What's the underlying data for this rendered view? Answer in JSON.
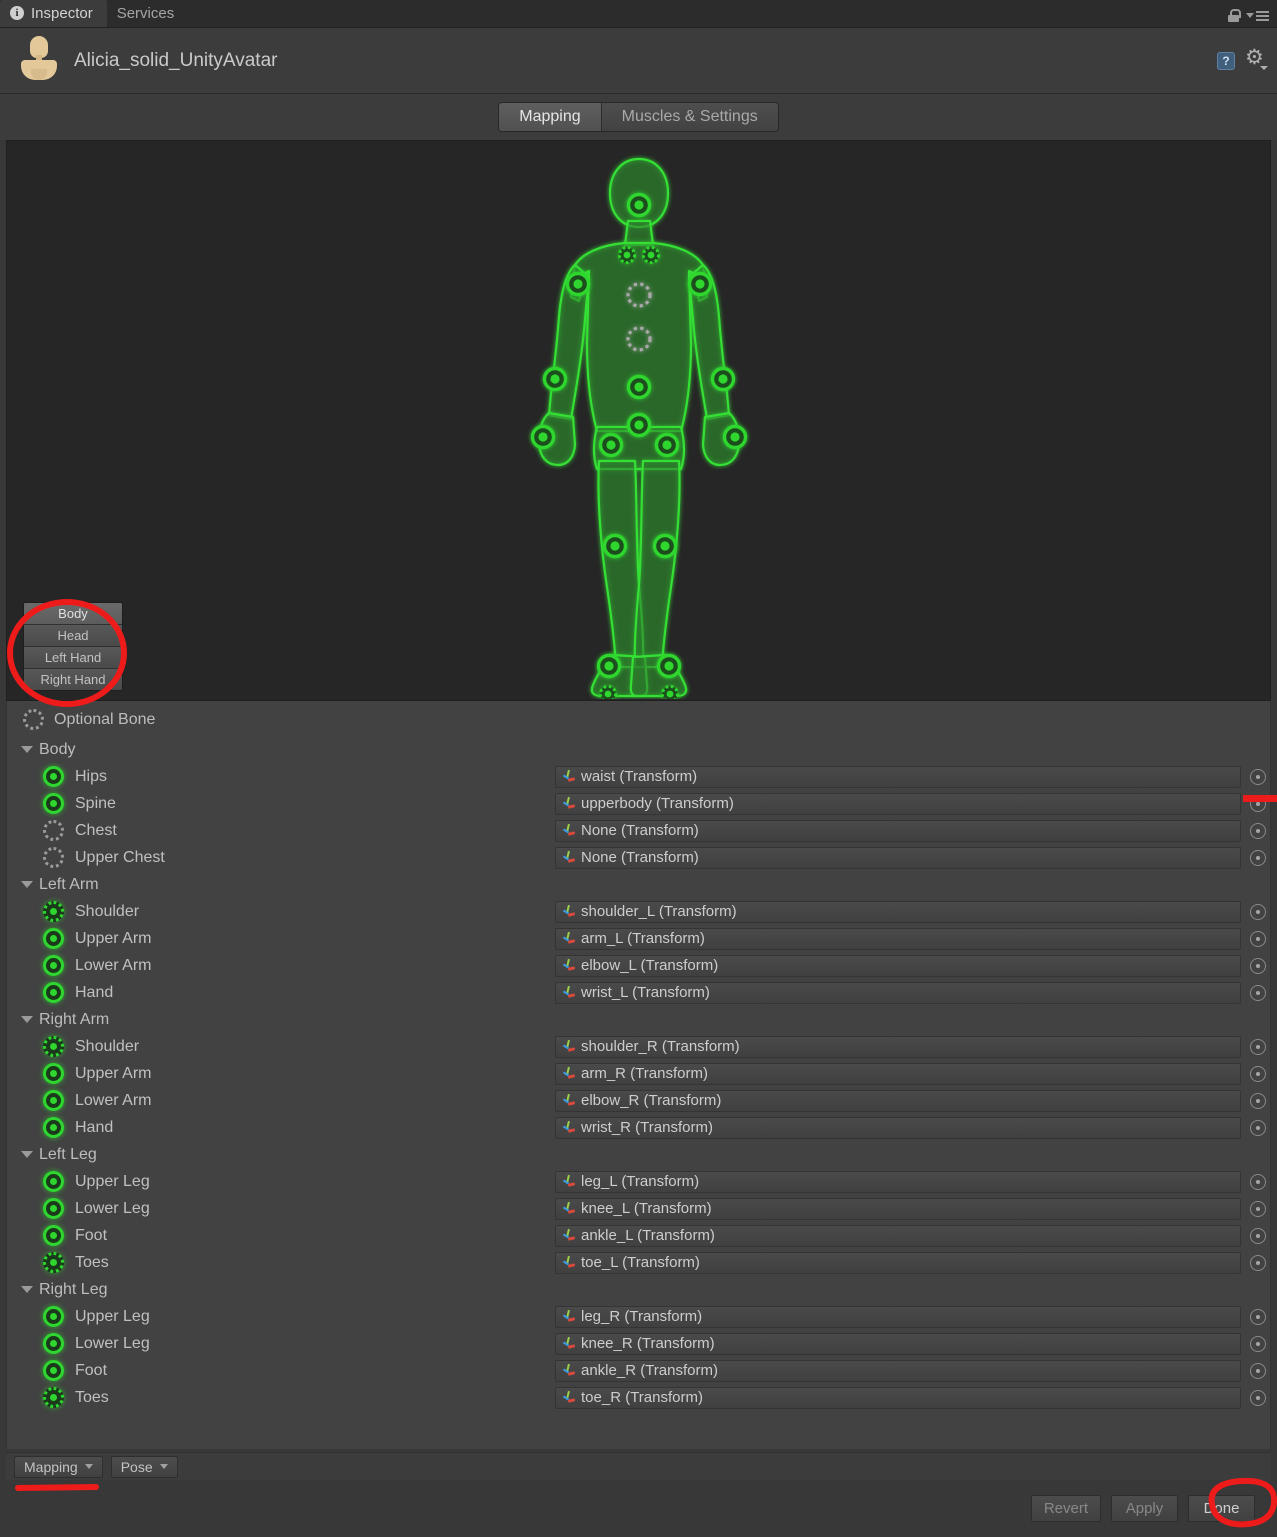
{
  "window": {
    "tabs": [
      {
        "label": "Inspector",
        "icon": "info-icon",
        "active": true
      },
      {
        "label": "Services",
        "icon": null,
        "active": false
      }
    ],
    "lock_icon": "lock-icon",
    "menu_icon": "hamburger-menu-icon"
  },
  "header": {
    "title": "Alicia_solid_UnityAvatar",
    "avatar_icon": "avatar-mannequin-icon",
    "help_icon": "help-icon",
    "help_glyph": "?",
    "settings_icon": "gear-icon"
  },
  "mode_tabs": [
    {
      "label": "Mapping",
      "active": true
    },
    {
      "label": "Muscles & Settings",
      "active": false
    }
  ],
  "preview": {
    "background_color": "#262626",
    "body_part_buttons": [
      {
        "label": "Body",
        "selected": true
      },
      {
        "label": "Head",
        "selected": false
      },
      {
        "label": "Left Hand",
        "selected": false
      },
      {
        "label": "Right Hand",
        "selected": false
      }
    ]
  },
  "legend": {
    "optional_bone_label": "Optional Bone",
    "optional_bone_icon": "dotted-circle-icon"
  },
  "colors": {
    "mapped_green": "#2fd62f",
    "unmapped_gray": "#9b9b9b",
    "annotation_red": "#ee1b1b",
    "panel_bg": "#424242"
  },
  "groups": [
    {
      "name": "Body",
      "expanded": true,
      "bones": [
        {
          "label": "Hips",
          "state": "mapped",
          "value": "waist (Transform)"
        },
        {
          "label": "Spine",
          "state": "mapped",
          "value": "upperbody (Transform)"
        },
        {
          "label": "Chest",
          "state": "empty",
          "value": "None (Transform)"
        },
        {
          "label": "Upper Chest",
          "state": "empty",
          "value": "None (Transform)"
        }
      ]
    },
    {
      "name": "Left Arm",
      "expanded": true,
      "bones": [
        {
          "label": "Shoulder",
          "state": "optmapped",
          "value": "shoulder_L (Transform)"
        },
        {
          "label": "Upper Arm",
          "state": "mapped",
          "value": "arm_L (Transform)"
        },
        {
          "label": "Lower Arm",
          "state": "mapped",
          "value": "elbow_L (Transform)"
        },
        {
          "label": "Hand",
          "state": "mapped",
          "value": "wrist_L (Transform)"
        }
      ]
    },
    {
      "name": "Right Arm",
      "expanded": true,
      "bones": [
        {
          "label": "Shoulder",
          "state": "optmapped",
          "value": "shoulder_R (Transform)"
        },
        {
          "label": "Upper Arm",
          "state": "mapped",
          "value": "arm_R (Transform)"
        },
        {
          "label": "Lower Arm",
          "state": "mapped",
          "value": "elbow_R (Transform)"
        },
        {
          "label": "Hand",
          "state": "mapped",
          "value": "wrist_R (Transform)"
        }
      ]
    },
    {
      "name": "Left Leg",
      "expanded": true,
      "bones": [
        {
          "label": "Upper Leg",
          "state": "mapped",
          "value": "leg_L (Transform)"
        },
        {
          "label": "Lower Leg",
          "state": "mapped",
          "value": "knee_L (Transform)"
        },
        {
          "label": "Foot",
          "state": "mapped",
          "value": "ankle_L (Transform)"
        },
        {
          "label": "Toes",
          "state": "optmapped",
          "value": "toe_L (Transform)"
        }
      ]
    },
    {
      "name": "Right Leg",
      "expanded": true,
      "bones": [
        {
          "label": "Upper Leg",
          "state": "mapped",
          "value": "leg_R (Transform)"
        },
        {
          "label": "Lower Leg",
          "state": "mapped",
          "value": "knee_R (Transform)"
        },
        {
          "label": "Foot",
          "state": "mapped",
          "value": "ankle_R (Transform)"
        },
        {
          "label": "Toes",
          "state": "optmapped",
          "value": "toe_R (Transform)"
        }
      ]
    }
  ],
  "bottom_toolbar": {
    "mapping_dropdown": "Mapping",
    "pose_dropdown": "Pose"
  },
  "footer": {
    "revert": "Revert",
    "apply": "Apply",
    "done": "Done"
  }
}
